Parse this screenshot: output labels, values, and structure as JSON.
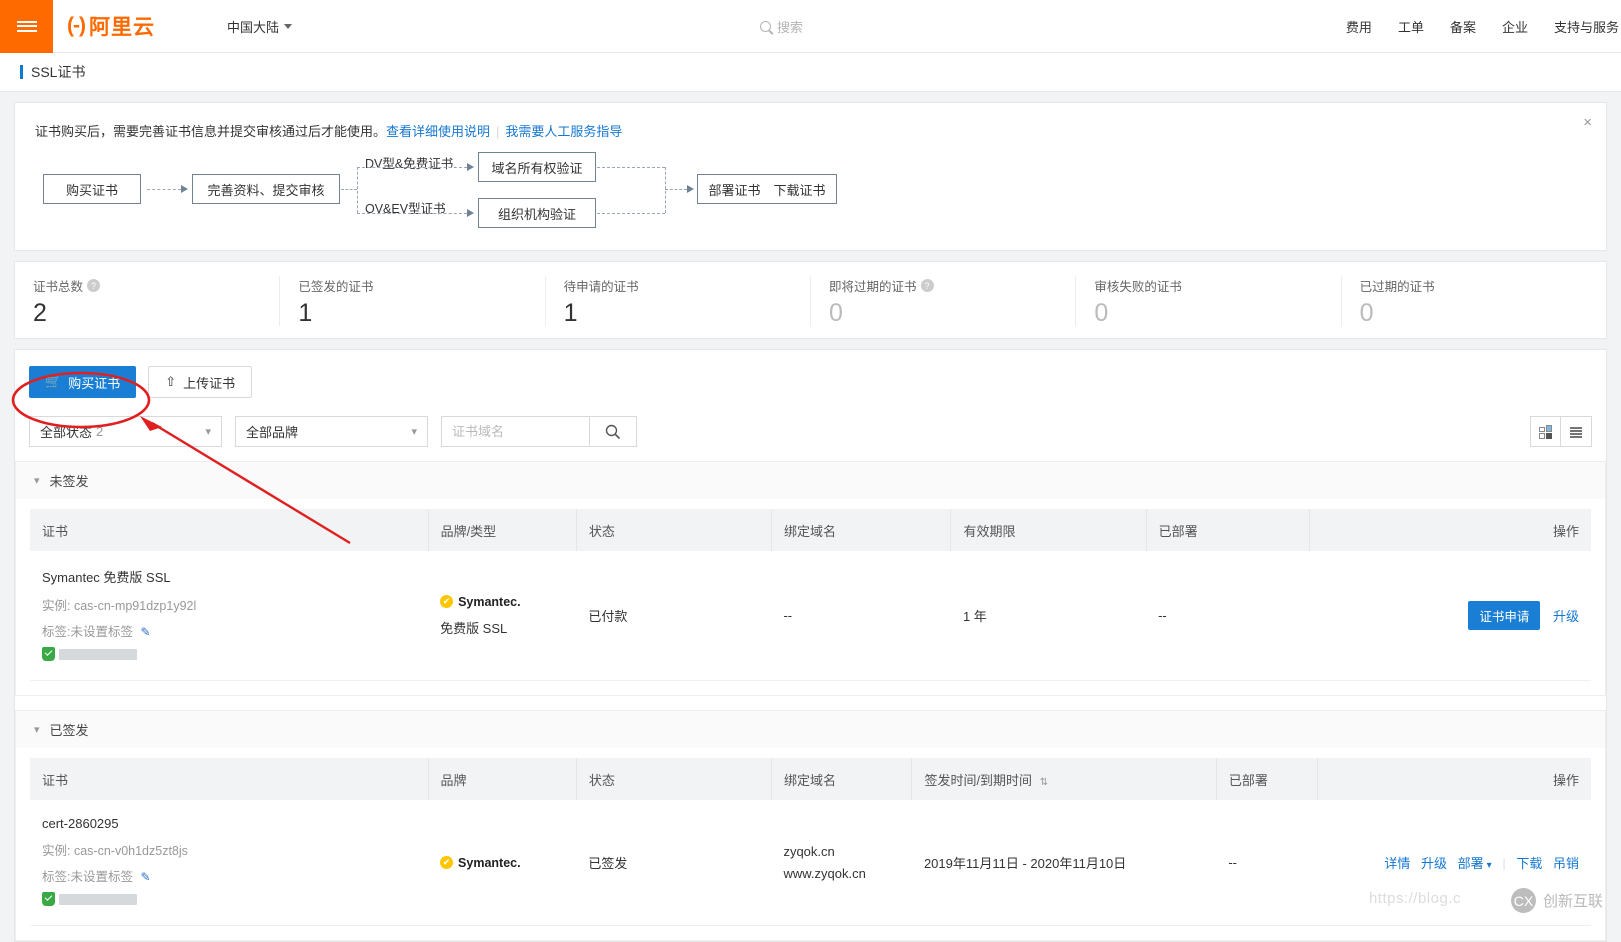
{
  "header": {
    "menu_icon": "hamburger-icon",
    "logo_text": "阿里云",
    "region": "中国大陆",
    "search_placeholder": "搜索",
    "nav": [
      {
        "label": "费用"
      },
      {
        "label": "工单"
      },
      {
        "label": "备案"
      },
      {
        "label": "企业"
      },
      {
        "label": "支持与服务"
      }
    ]
  },
  "page": {
    "title": "SSL证书"
  },
  "notice": {
    "text": "证书购买后，需要完善证书信息并提交审核通过后才能使用。",
    "link1": "查看详细使用说明",
    "link2": "我需要人工服务指导",
    "close": "×"
  },
  "flow": {
    "step1": "购买证书",
    "step2": "完善资料、提交审核",
    "branch1_label": "DV型&免费证书",
    "branch2_label": "OV&EV型证书",
    "branch1_box": "域名所有权验证",
    "branch2_box": "组织机构验证",
    "step_final": "部署证书　下载证书"
  },
  "stats": [
    {
      "label": "证书总数",
      "value": "2",
      "has_help": true
    },
    {
      "label": "已签发的证书",
      "value": "1",
      "has_help": false
    },
    {
      "label": "待申请的证书",
      "value": "1",
      "has_help": false
    },
    {
      "label": "即将过期的证书",
      "value": "0",
      "has_help": true
    },
    {
      "label": "审核失败的证书",
      "value": "0",
      "has_help": false
    },
    {
      "label": "已过期的证书",
      "value": "0",
      "has_help": false
    }
  ],
  "toolbar": {
    "buy_label": "购买证书",
    "upload_label": "上传证书",
    "status_filter": "全部状态",
    "status_count": "2",
    "brand_filter": "全部品牌",
    "search_placeholder": "证书域名"
  },
  "sections": [
    {
      "title": "未签发",
      "columns": [
        "证书",
        "品牌/类型",
        "状态",
        "绑定域名",
        "有效期限",
        "已部署",
        "操作"
      ],
      "rows": [
        {
          "name": "Symantec 免费版 SSL",
          "instance_label": "实例:",
          "instance": "cas-cn-mp91dzp1y92l",
          "tag_label": "标签:",
          "tag_value": "未设置标签",
          "brand": "Symantec.",
          "brand_type": "免费版 SSL",
          "status": "已付款",
          "domain": "--",
          "period": "1 年",
          "deployed": "--",
          "primary_action": "证书申请",
          "secondary_action": "升级"
        }
      ]
    },
    {
      "title": "已签发",
      "columns": [
        "证书",
        "品牌",
        "状态",
        "绑定域名",
        "签发时间/到期时间",
        "已部署",
        "操作"
      ],
      "sort_column_index": 4,
      "rows": [
        {
          "name": "cert-2860295",
          "instance_label": "实例:",
          "instance": "cas-cn-v0h1dz5zt8js",
          "tag_label": "标签:",
          "tag_value": "未设置标签",
          "brand": "Symantec.",
          "status": "已签发",
          "domain_line1": "zyqok.cn",
          "domain_line2": "www.zyqok.cn",
          "period": "2019年11月11日 - 2020年11月10日",
          "deployed": "--",
          "actions": [
            "详情",
            "升级",
            "部署"
          ],
          "actions_right": [
            "下载",
            "吊销"
          ]
        }
      ]
    }
  ],
  "annotation": {
    "highlight_target": "购买证书",
    "color": "#e02020"
  },
  "watermark": {
    "url_text": "https://blog.c",
    "brand": "创新互联",
    "brand_mark": "CX"
  },
  "colors": {
    "accent_orange": "#ff6a00",
    "primary_blue": "#1a7fd4",
    "link_blue": "#1677d2",
    "annotation_red": "#e02020"
  }
}
